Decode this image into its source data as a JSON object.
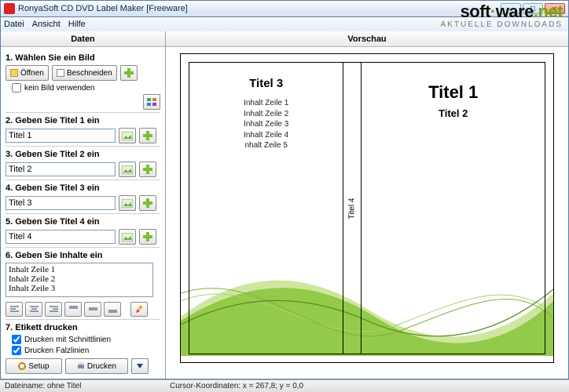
{
  "window": {
    "title": "RonyaSoft CD DVD Label Maker [Freeware]"
  },
  "watermark": {
    "soft": "soft",
    "ware": "ware",
    "net": "net",
    "sub": "AKTUELLE DOWNLOADS"
  },
  "menu": {
    "file": "Datei",
    "view": "Ansicht",
    "help": "Hilfe"
  },
  "panes": {
    "left": "Daten",
    "right": "Vorschau"
  },
  "sections": {
    "s1": "1. Wählen Sie ein Bild",
    "s2": "2. Geben Sie Titel 1 ein",
    "s3": "3. Geben Sie Titel 2 ein",
    "s4": "4. Geben Sie Titel 3 ein",
    "s5": "5. Geben Sie Titel 4 ein",
    "s6": "6. Geben Sie Inhalte ein",
    "s7": "7. Etikett drucken"
  },
  "buttons": {
    "open": "Öffnen",
    "crop": "Beschneiden",
    "noimage": "kein Bild verwenden",
    "cutlines": "Drucken mit Schnittlinien",
    "foldlines": "Drucken Falzlinien",
    "setup": "Setup",
    "print": "Drucken"
  },
  "fields": {
    "title1": "Titel 1",
    "title2": "Titel 2",
    "title3": "Titel 3",
    "title4": "Titel 4",
    "content": "Inhalt Zeile 1\nInhalt Zeile 2\nInhalt Zeile 3"
  },
  "preview": {
    "title3": "Titel 3",
    "contentLines": [
      "Inhalt Zeile 1",
      "Inhalt  Zeile 2",
      "Inhalt Zeile 3",
      "Inhalt Zeile 4",
      "nhalt Zeile 5"
    ],
    "spine": "Titel 4",
    "title1": "Titel 1",
    "title2": "Titel 2"
  },
  "status": {
    "filename_label": "Dateiname: ",
    "filename": "ohne Titel",
    "cursor": "Cursor-Koordinaten: x = 267,8; y =   0,0"
  }
}
